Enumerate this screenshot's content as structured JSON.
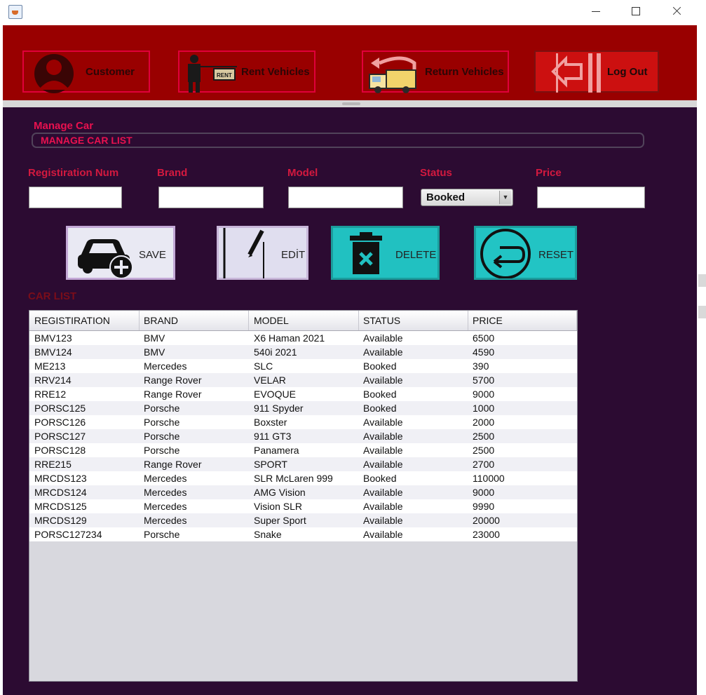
{
  "nav": {
    "customer": "Customer",
    "rent": "Rent Vehicles",
    "return": "Return Vehicles",
    "logout": "Log Out"
  },
  "section": {
    "title": "Manage Car",
    "bar": "MANAGE CAR LIST"
  },
  "form": {
    "reg_label": "Registiration Num",
    "brand_label": "Brand",
    "model_label": "Model",
    "status_label": "Status",
    "price_label": "Price",
    "reg_value": "",
    "brand_value": "",
    "model_value": "",
    "status_value": "Booked",
    "price_value": ""
  },
  "actions": {
    "save": "SAVE",
    "edit": "EDİT",
    "delete": "DELETE",
    "reset": "RESET"
  },
  "car_list_label": "CAR LIST",
  "table": {
    "headers": [
      "REGISTIRATION",
      "BRAND",
      "MODEL",
      "STATUS",
      "PRICE"
    ],
    "rows": [
      [
        "BMV123",
        "BMV",
        "X6 Haman  2021",
        "Available",
        "6500"
      ],
      [
        "BMV124",
        "BMV",
        "540i 2021",
        "Available",
        "4590"
      ],
      [
        "ME213",
        "Mercedes",
        "SLC",
        "Booked",
        "390"
      ],
      [
        "RRV214",
        "Range Rover",
        "VELAR",
        "Available",
        "5700"
      ],
      [
        "RRE12",
        "Range Rover",
        "EVOQUE",
        "Booked",
        "9000"
      ],
      [
        "PORSC125",
        "Porsche",
        "911 Spyder",
        "Booked",
        "1000"
      ],
      [
        "PORSC126",
        "Porsche",
        "Boxster",
        "Available",
        "2000"
      ],
      [
        "PORSC127",
        "Porsche",
        "911 GT3",
        "Available",
        "2500"
      ],
      [
        "PORSC128",
        "Porsche",
        "Panamera",
        "Available",
        "2500"
      ],
      [
        "RRE215",
        "Range Rover",
        "SPORT",
        "Available",
        "2700"
      ],
      [
        "MRCDS123",
        "Mercedes",
        "SLR McLaren 999",
        "Booked",
        "110000"
      ],
      [
        "MRCDS124",
        "Mercedes",
        "AMG Vision",
        "Available",
        "9000"
      ],
      [
        "MRCDS125",
        "Mercedes",
        "Vision SLR",
        "Available",
        "9990"
      ],
      [
        "MRCDS129",
        "Mercedes",
        "Super Sport",
        "Available",
        "20000"
      ],
      [
        "PORSC127234",
        "Porsche",
        "Snake",
        "Available",
        "23000"
      ]
    ]
  },
  "colors": {
    "header_bg": "#990000",
    "frame_bg": "#2c0b32",
    "accent_pink": "#e8114f",
    "teal": "#21c1c1"
  },
  "icons": {
    "app": "java-cup-icon",
    "customer": "user-avatar-icon",
    "rent": "rent-sign-person-icon",
    "return": "return-truck-icon",
    "logout": "logout-arrow-icon",
    "save": "car-add-icon",
    "edit": "pencil-icon",
    "delete": "trash-icon",
    "reset": "undo-arrow-icon"
  }
}
